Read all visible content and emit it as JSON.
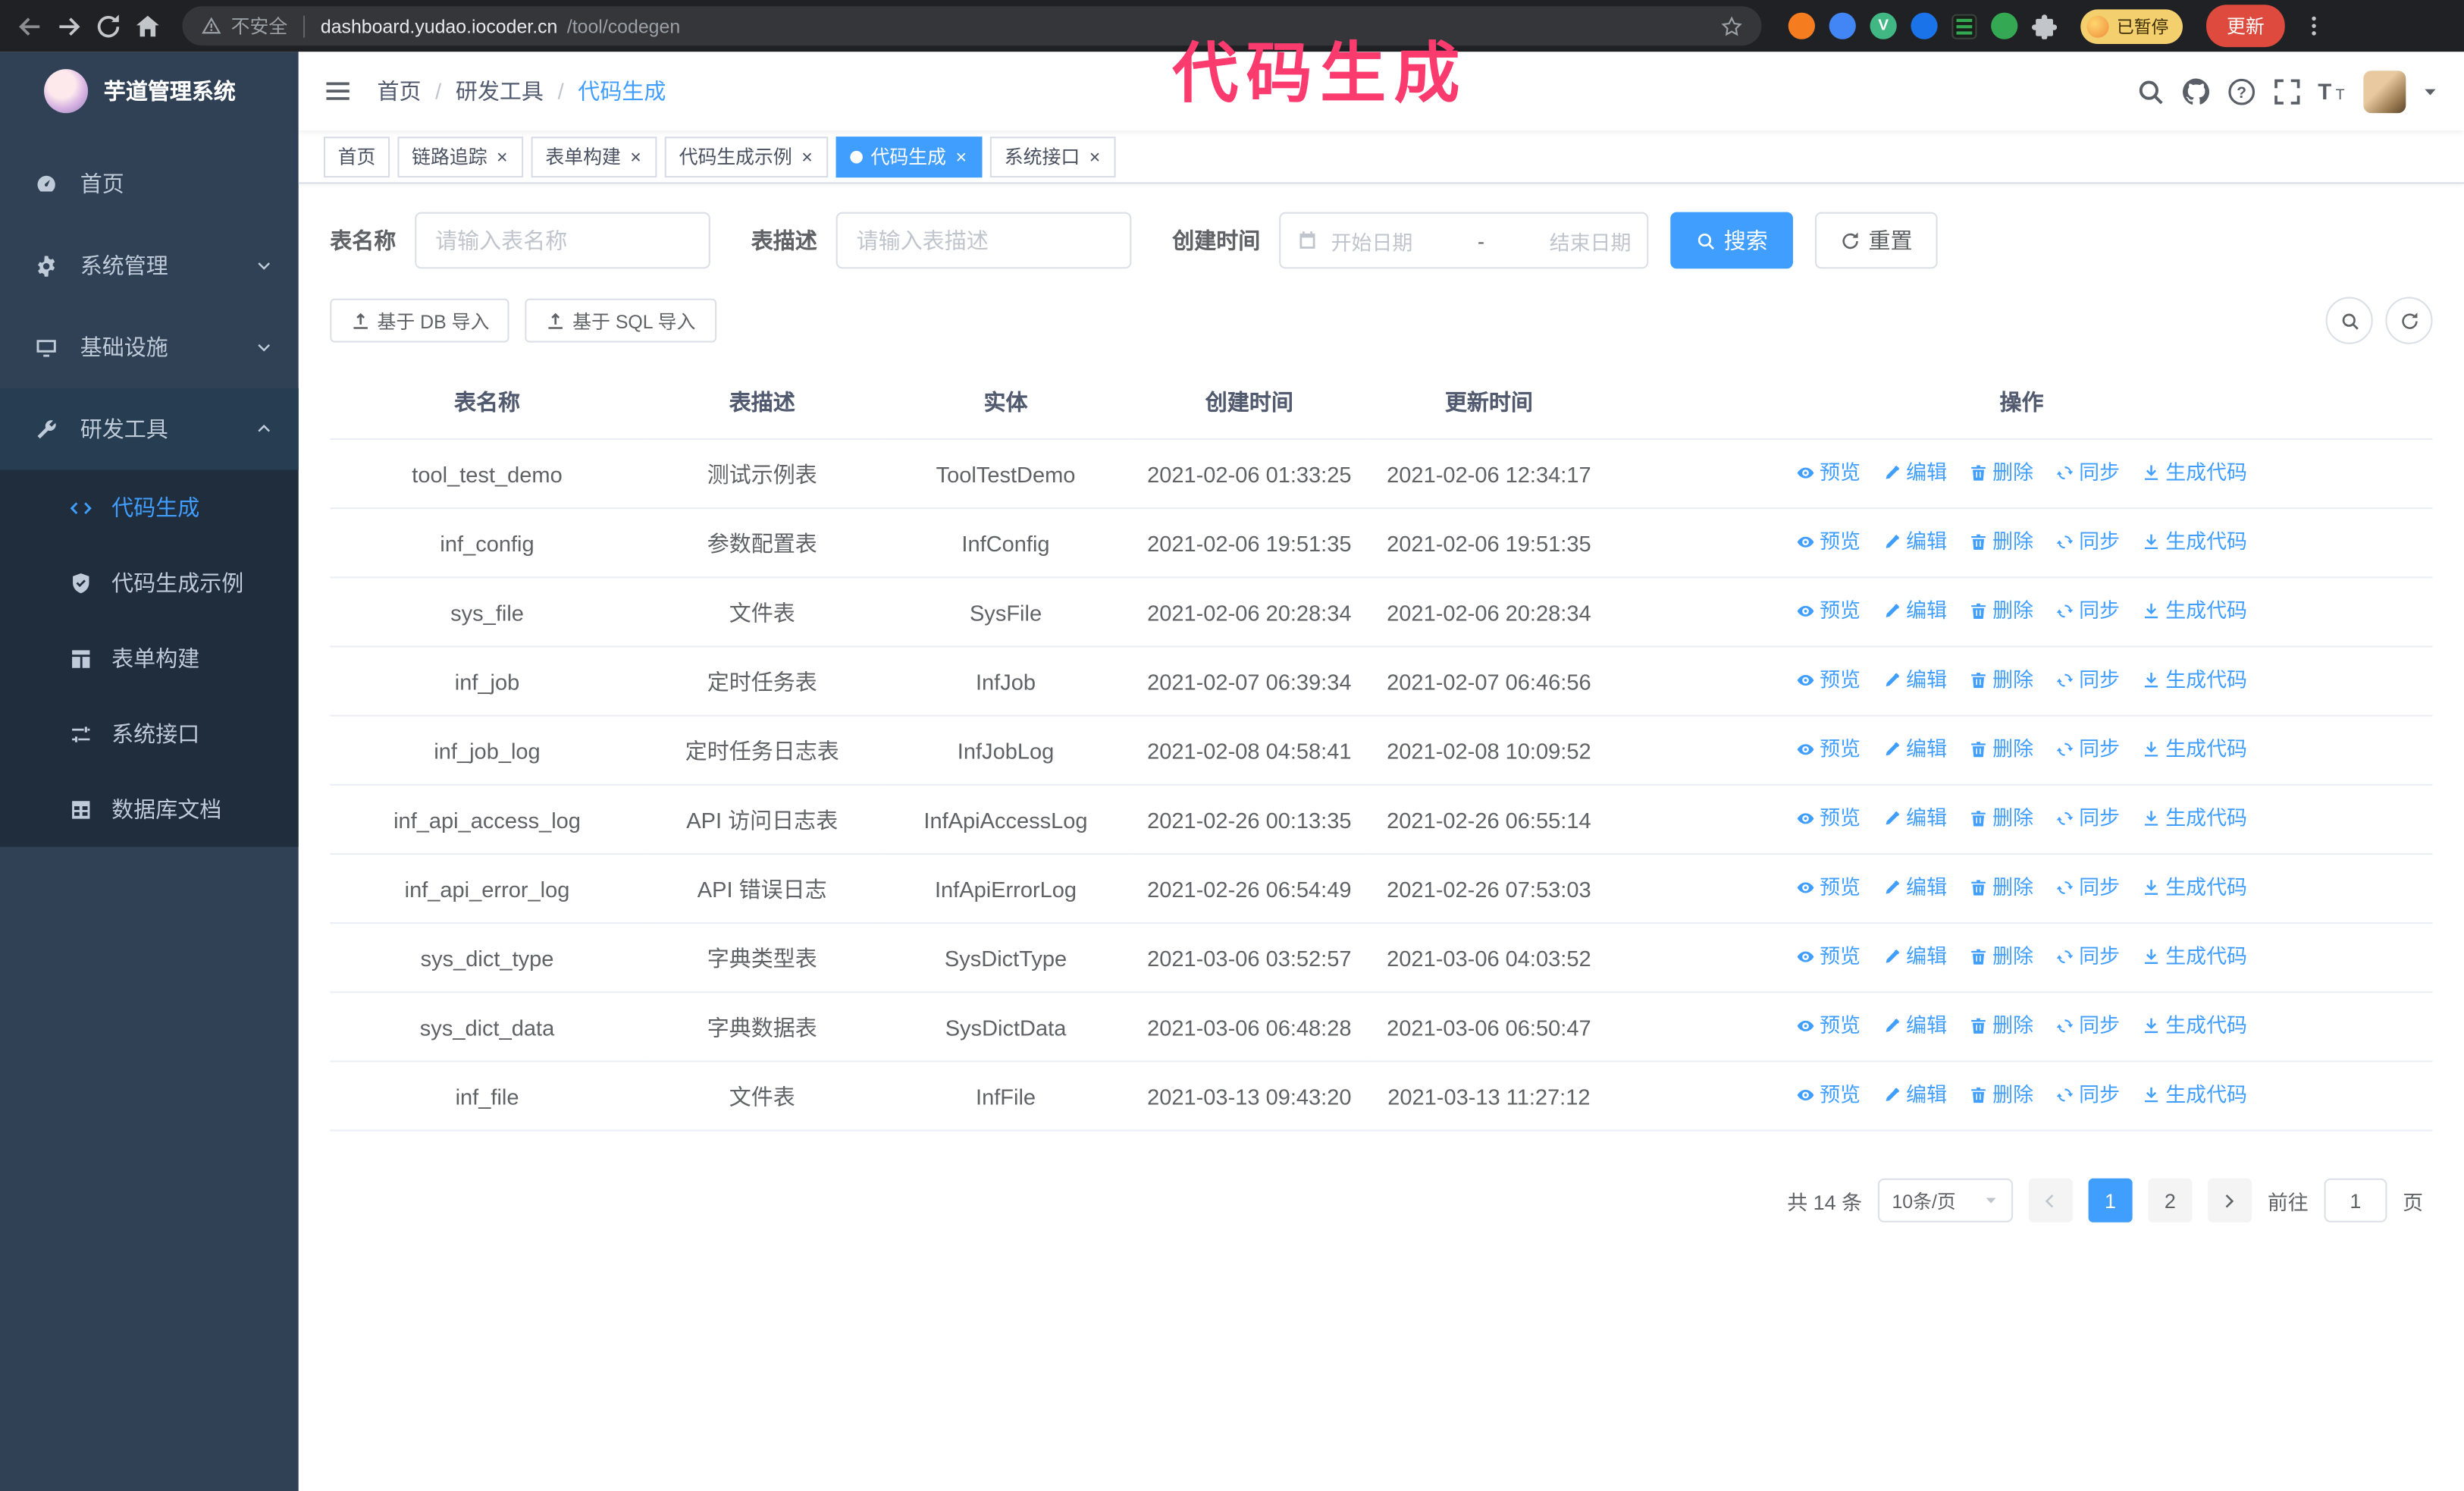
{
  "browser": {
    "security_warning": "不安全",
    "url_domain": "dashboard.yudao.iocoder.cn",
    "url_path": "/tool/codegen",
    "paused_badge": "已暂停",
    "update_button": "更新"
  },
  "annotation": {
    "text": "代码生成",
    "color": "#fb3b6e"
  },
  "sidebar": {
    "logo_title": "芋道管理系统",
    "items": [
      {
        "label": "首页",
        "icon": "dashboard-icon",
        "expandable": false,
        "expanded": false
      },
      {
        "label": "系统管理",
        "icon": "gear-icon",
        "expandable": true,
        "expanded": false
      },
      {
        "label": "基础设施",
        "icon": "monitor-icon",
        "expandable": true,
        "expanded": false
      },
      {
        "label": "研发工具",
        "icon": "tool-icon",
        "expandable": true,
        "expanded": true
      }
    ],
    "subitems": [
      {
        "label": "代码生成",
        "icon": "code-icon",
        "active": true
      },
      {
        "label": "代码生成示例",
        "icon": "shield-check-icon",
        "active": false
      },
      {
        "label": "表单构建",
        "icon": "form-icon",
        "active": false
      },
      {
        "label": "系统接口",
        "icon": "sliders-icon",
        "active": false
      },
      {
        "label": "数据库文档",
        "icon": "table-grid-icon",
        "active": false
      }
    ]
  },
  "header": {
    "breadcrumb": [
      "首页",
      "研发工具",
      "代码生成"
    ]
  },
  "tabs": [
    {
      "label": "首页",
      "closable": false,
      "active": false
    },
    {
      "label": "链路追踪",
      "closable": true,
      "active": false
    },
    {
      "label": "表单构建",
      "closable": true,
      "active": false
    },
    {
      "label": "代码生成示例",
      "closable": true,
      "active": false
    },
    {
      "label": "代码生成",
      "closable": true,
      "active": true
    },
    {
      "label": "系统接口",
      "closable": true,
      "active": false
    }
  ],
  "filters": {
    "table_name_label": "表名称",
    "table_name_placeholder": "请输入表名称",
    "table_desc_label": "表描述",
    "table_desc_placeholder": "请输入表描述",
    "create_time_label": "创建时间",
    "date_start_placeholder": "开始日期",
    "date_separator": "-",
    "date_end_placeholder": "结束日期",
    "search_button": "搜索",
    "reset_button": "重置"
  },
  "toolbar": {
    "import_db_button": "基于 DB 导入",
    "import_sql_button": "基于 SQL 导入"
  },
  "table": {
    "columns": [
      "表名称",
      "表描述",
      "实体",
      "创建时间",
      "更新时间",
      "操作"
    ],
    "actions": [
      {
        "label": "预览",
        "icon": "eye-icon",
        "name": "preview-action"
      },
      {
        "label": "编辑",
        "icon": "edit-icon",
        "name": "edit-action"
      },
      {
        "label": "删除",
        "icon": "delete-icon",
        "name": "delete-action"
      },
      {
        "label": "同步",
        "icon": "sync-icon",
        "name": "sync-action"
      },
      {
        "label": "生成代码",
        "icon": "download-icon",
        "name": "generate-code-action"
      }
    ],
    "rows": [
      {
        "name": "tool_test_demo",
        "desc": "测试示例表",
        "entity": "ToolTestDemo",
        "created": "2021-02-06 01:33:25",
        "updated": "2021-02-06 12:34:17"
      },
      {
        "name": "inf_config",
        "desc": "参数配置表",
        "entity": "InfConfig",
        "created": "2021-02-06 19:51:35",
        "updated": "2021-02-06 19:51:35"
      },
      {
        "name": "sys_file",
        "desc": "文件表",
        "entity": "SysFile",
        "created": "2021-02-06 20:28:34",
        "updated": "2021-02-06 20:28:34"
      },
      {
        "name": "inf_job",
        "desc": "定时任务表",
        "entity": "InfJob",
        "created": "2021-02-07 06:39:34",
        "updated": "2021-02-07 06:46:56"
      },
      {
        "name": "inf_job_log",
        "desc": "定时任务日志表",
        "entity": "InfJobLog",
        "created": "2021-02-08 04:58:41",
        "updated": "2021-02-08 10:09:52"
      },
      {
        "name": "inf_api_access_log",
        "desc": "API 访问日志表",
        "entity": "InfApiAccessLog",
        "created": "2021-02-26 00:13:35",
        "updated": "2021-02-26 06:55:14"
      },
      {
        "name": "inf_api_error_log",
        "desc": "API 错误日志",
        "entity": "InfApiErrorLog",
        "created": "2021-02-26 06:54:49",
        "updated": "2021-02-26 07:53:03"
      },
      {
        "name": "sys_dict_type",
        "desc": "字典类型表",
        "entity": "SysDictType",
        "created": "2021-03-06 03:52:57",
        "updated": "2021-03-06 04:03:52"
      },
      {
        "name": "sys_dict_data",
        "desc": "字典数据表",
        "entity": "SysDictData",
        "created": "2021-03-06 06:48:28",
        "updated": "2021-03-06 06:50:47"
      },
      {
        "name": "inf_file",
        "desc": "文件表",
        "entity": "InfFile",
        "created": "2021-03-13 09:43:20",
        "updated": "2021-03-13 11:27:12"
      }
    ]
  },
  "pagination": {
    "total": "共 14 条",
    "page_size": "10条/页",
    "pages": [
      "1",
      "2"
    ],
    "active_page": "1",
    "goto_label": "前往",
    "goto_value": "1",
    "page_suffix": "页"
  },
  "colors": {
    "accent": "#409eff",
    "sidebar_bg": "#304156",
    "submenu_bg": "#1f2d3d",
    "annotation": "#fb3b6e"
  }
}
